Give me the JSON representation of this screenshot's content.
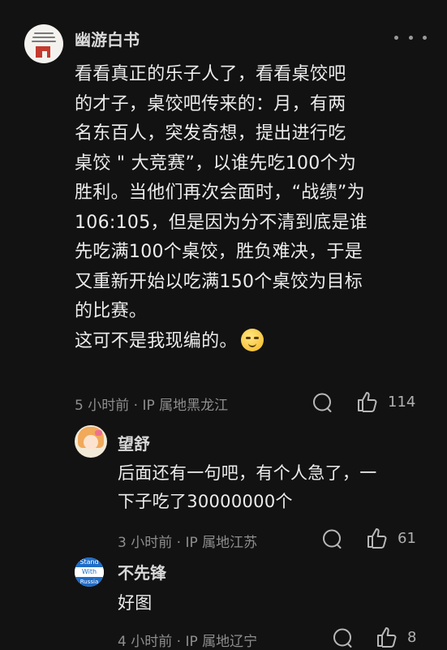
{
  "main_comment": {
    "username": "幽游白书",
    "lines": [
      "看看真正的乐子人了，看看桌饺吧",
      "的才子，桌饺吧传来的：月，有两",
      "名东百人，突发奇想，提出进行吃",
      "桌饺 \" 大竞赛”，以谁先吃100个为",
      "胜利。当他们再次会面时，“战绩”为",
      "106:105，但是因为分不清到底是谁",
      "先吃满100个桌饺，胜负难决，于是",
      "又重新开始以吃满150个桌饺为目标",
      "的比赛。",
      "这可不是我现编的。"
    ],
    "emoji": "smirk-emoji",
    "time": "5 小时前",
    "location": "IP 属地黑龙江",
    "likes": "114"
  },
  "replies": [
    {
      "username": "望舒",
      "lines": [
        "后面还有一句吧，有个人急了，一",
        "下子吃了30000000个"
      ],
      "time": "3 小时前",
      "location": "IP 属地江苏",
      "likes": "61"
    },
    {
      "username": "不先锋",
      "avatar_text": [
        "Stand",
        "With",
        "Russia"
      ],
      "lines": [
        "好图"
      ],
      "time": "4 小时前",
      "location": "IP 属地辽宁",
      "likes": "8"
    }
  ],
  "meta_separator": "·",
  "icons": {
    "more": "more-dots-icon",
    "comment": "comment-bubble-icon",
    "like": "thumbs-up-icon"
  },
  "colors": {
    "background": "#121212",
    "text": "#ececec",
    "meta": "#8e8e8e"
  }
}
